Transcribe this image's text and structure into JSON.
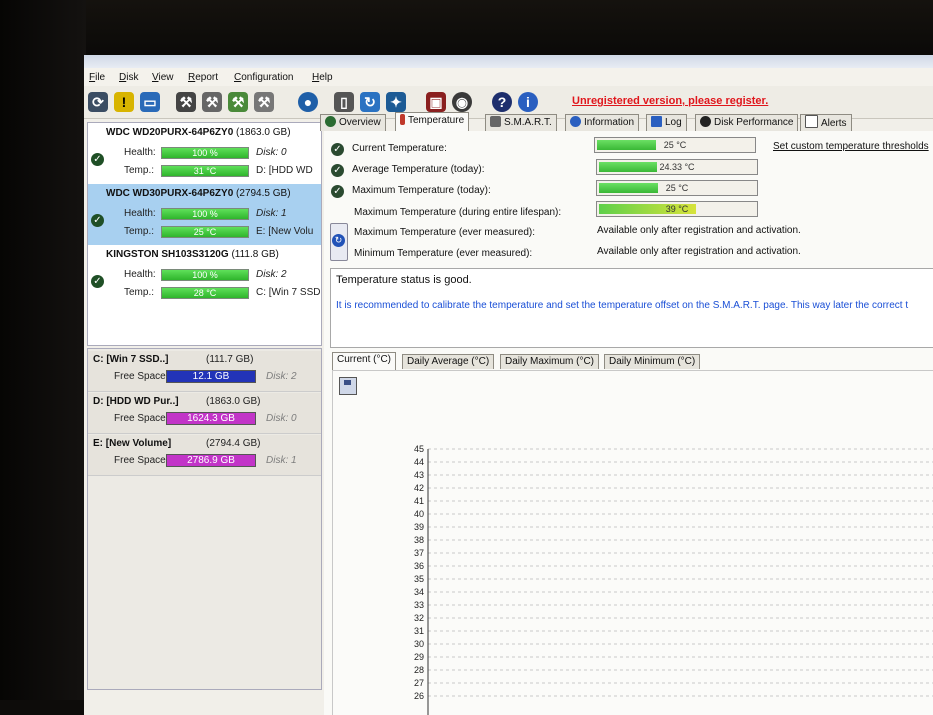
{
  "menu": [
    "File",
    "Disk",
    "View",
    "Report",
    "Configuration",
    "Help"
  ],
  "unregistered_text": "Unregistered version, please register.",
  "disks": [
    {
      "model": "WDC WD20PURX-64P6ZY0",
      "size": "(1863.0 GB)",
      "health_label": "Health:",
      "health": "100 %",
      "temp_label": "Temp.:",
      "temp": "31 °C",
      "disk_no": "Disk: 0",
      "drive": "D: [HDD WD",
      "selected": false
    },
    {
      "model": "WDC WD30PURX-64P6ZY0",
      "size": "(2794.5 GB)",
      "health_label": "Health:",
      "health": "100 %",
      "temp_label": "Temp.:",
      "temp": "25 °C",
      "disk_no": "Disk: 1",
      "drive": "E: [New Volu",
      "selected": true
    },
    {
      "model": "KINGSTON SH103S3120G",
      "size": "(111.8 GB)",
      "health_label": "Health:",
      "health": "100 %",
      "temp_label": "Temp.:",
      "temp": "28 °C",
      "disk_no": "Disk: 2",
      "drive": "C: [Win 7 SSD",
      "selected": false
    }
  ],
  "volumes": [
    {
      "name": "C: [Win 7 SSD..]",
      "size": "(111.7 GB)",
      "free_label": "Free Space",
      "free": "12.1 GB",
      "disk": "Disk: 2",
      "color": "#2233b8"
    },
    {
      "name": "D: [HDD WD Pur..]",
      "size": "(1863.0 GB)",
      "free_label": "Free Space",
      "free": "1624.3 GB",
      "disk": "Disk: 0",
      "color": "#c234c8"
    },
    {
      "name": "E: [New Volume]",
      "size": "(2794.4 GB)",
      "free_label": "Free Space",
      "free": "2786.9 GB",
      "disk": "Disk: 1",
      "color": "#c234c8"
    }
  ],
  "tabs": [
    "Overview",
    "Temperature",
    "S.M.A.R.T.",
    "Information",
    "Log",
    "Disk Performance",
    "Alerts"
  ],
  "temperature": {
    "current_label": "Current Temperature:",
    "current": "25 °C",
    "current_fill": 0.38,
    "avg_label": "Average Temperature (today):",
    "avg": "24.33 °C",
    "avg_fill": 0.37,
    "max_label": "Maximum Temperature (today):",
    "max": "25 °C",
    "max_fill": 0.38,
    "life_label": "Maximum Temperature (during entire lifespan):",
    "life": "39 °C",
    "life_fill": 0.62,
    "ever_max_label": "Maximum Temperature (ever measured):",
    "ever_max": "Available only after registration and activation.",
    "ever_min_label": "Minimum Temperature (ever measured):",
    "ever_min": "Available only after registration and activation.",
    "thresholds_link": "Set custom temperature thresholds"
  },
  "status": {
    "line1": "Temperature status is good.",
    "line2": "It is recommended to calibrate the temperature and set the temperature offset on the S.M.A.R.T. page. This way later the correct t"
  },
  "subtabs": [
    "Current (°C)",
    "Daily Average (°C)",
    "Daily Maximum (°C)",
    "Daily Minimum (°C)"
  ],
  "chart_data": {
    "type": "line",
    "y_ticks": [
      45,
      44,
      43,
      42,
      41,
      40,
      39,
      38,
      37,
      36,
      35,
      34,
      33,
      32,
      31,
      30,
      29,
      28,
      27,
      26
    ],
    "ylim": [
      26,
      45
    ],
    "grid": true
  }
}
